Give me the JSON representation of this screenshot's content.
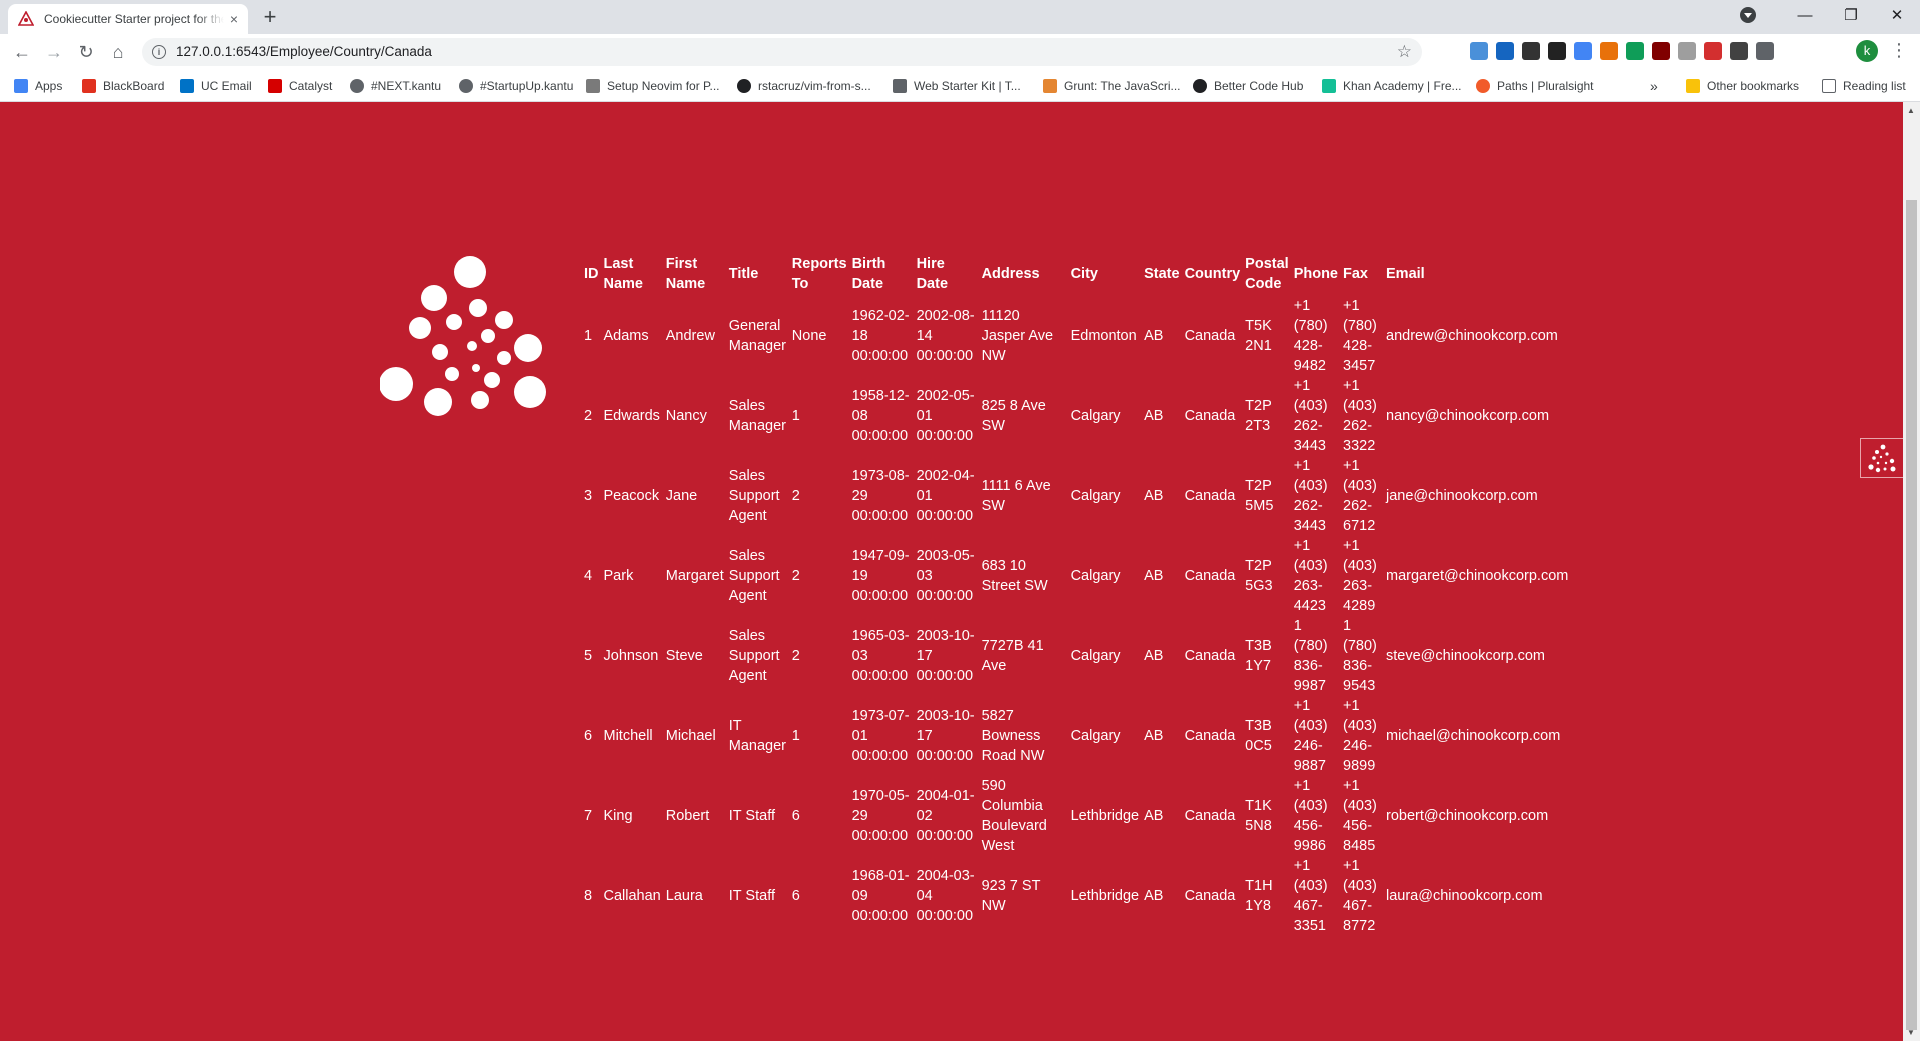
{
  "browser": {
    "tab_title": "Cookiecutter Starter project for the Pyramid Web Framework",
    "tab_close": "×",
    "new_tab": "+",
    "url": "127.0.0.1:6543/Employee/Country/Canada",
    "profile_initial": "k",
    "window_controls": {
      "minimize": "—",
      "restore": "❐",
      "close": "✕"
    }
  },
  "bookmarks": {
    "items": [
      {
        "label": "Apps",
        "icon": "apps-grid-icon",
        "color": "#4285f4"
      },
      {
        "label": "BlackBoard",
        "icon": "blackboard-icon",
        "color": "#e0311f"
      },
      {
        "label": "UC Email",
        "icon": "outlook-icon",
        "color": "#0072c6"
      },
      {
        "label": "Catalyst",
        "icon": "catalyst-icon",
        "color": "#d50000"
      },
      {
        "label": "#NEXT.kantu",
        "icon": "globe-icon",
        "color": "#5f6368"
      },
      {
        "label": "#StartupUp.kantu",
        "icon": "globe-icon",
        "color": "#5f6368"
      },
      {
        "label": "Setup Neovim for P...",
        "icon": "neovim-icon",
        "color": "#7a7a7a"
      },
      {
        "label": "rstacruz/vim-from-s...",
        "icon": "github-icon",
        "color": "#202124"
      },
      {
        "label": "Web Starter Kit | T...",
        "icon": "code-icon",
        "color": "#5f6368"
      },
      {
        "label": "Grunt: The JavaScri...",
        "icon": "grunt-icon",
        "color": "#e48632"
      },
      {
        "label": "Better Code Hub",
        "icon": "github-icon",
        "color": "#202124"
      },
      {
        "label": "Khan Academy | Fre...",
        "icon": "khan-icon",
        "color": "#14bf96"
      },
      {
        "label": "Paths | Pluralsight",
        "icon": "pluralsight-icon",
        "color": "#f15b2a"
      }
    ],
    "overflow": "»",
    "other": "Other bookmarks",
    "reading": "Reading list"
  },
  "table": {
    "headers": {
      "id": "ID",
      "last": "Last Name",
      "first": "First Name",
      "title": "Title",
      "reports": "Reports To",
      "birth": "Birth Date",
      "hire": "Hire Date",
      "address": "Address",
      "city": "City",
      "state": "State",
      "country": "Country",
      "postal": "Postal Code",
      "phone": "Phone",
      "fax": "Fax",
      "email": "Email"
    },
    "rows": [
      {
        "id": "1",
        "last": "Adams",
        "first": "Andrew",
        "title": "General Manager",
        "reports": "None",
        "birth": "1962-02-18 00:00:00",
        "hire": "2002-08-14 00:00:00",
        "address": "11120 Jasper Ave NW",
        "city": "Edmonton",
        "state": "AB",
        "country": "Canada",
        "postal": "T5K 2N1",
        "phone": "+1 (780) 428-9482",
        "fax": "+1 (780) 428-3457",
        "email": "andrew@chinookcorp.com"
      },
      {
        "id": "2",
        "last": "Edwards",
        "first": "Nancy",
        "title": "Sales Manager",
        "reports": "1",
        "birth": "1958-12-08 00:00:00",
        "hire": "2002-05-01 00:00:00",
        "address": "825 8 Ave SW",
        "city": "Calgary",
        "state": "AB",
        "country": "Canada",
        "postal": "T2P 2T3",
        "phone": "+1 (403) 262-3443",
        "fax": "+1 (403) 262-3322",
        "email": "nancy@chinookcorp.com"
      },
      {
        "id": "3",
        "last": "Peacock",
        "first": "Jane",
        "title": "Sales Support Agent",
        "reports": "2",
        "birth": "1973-08-29 00:00:00",
        "hire": "2002-04-01 00:00:00",
        "address": "1111 6 Ave SW",
        "city": "Calgary",
        "state": "AB",
        "country": "Canada",
        "postal": "T2P 5M5",
        "phone": "+1 (403) 262-3443",
        "fax": "+1 (403) 262-6712",
        "email": "jane@chinookcorp.com"
      },
      {
        "id": "4",
        "last": "Park",
        "first": "Margaret",
        "title": "Sales Support Agent",
        "reports": "2",
        "birth": "1947-09-19 00:00:00",
        "hire": "2003-05-03 00:00:00",
        "address": "683 10 Street SW",
        "city": "Calgary",
        "state": "AB",
        "country": "Canada",
        "postal": "T2P 5G3",
        "phone": "+1 (403) 263-4423",
        "fax": "+1 (403) 263-4289",
        "email": "margaret@chinookcorp.com"
      },
      {
        "id": "5",
        "last": "Johnson",
        "first": "Steve",
        "title": "Sales Support Agent",
        "reports": "2",
        "birth": "1965-03-03 00:00:00",
        "hire": "2003-10-17 00:00:00",
        "address": "7727B 41 Ave",
        "city": "Calgary",
        "state": "AB",
        "country": "Canada",
        "postal": "T3B 1Y7",
        "phone": "1 (780) 836-9987",
        "fax": "1 (780) 836-9543",
        "email": "steve@chinookcorp.com"
      },
      {
        "id": "6",
        "last": "Mitchell",
        "first": "Michael",
        "title": "IT Manager",
        "reports": "1",
        "birth": "1973-07-01 00:00:00",
        "hire": "2003-10-17 00:00:00",
        "address": "5827 Bowness Road NW",
        "city": "Calgary",
        "state": "AB",
        "country": "Canada",
        "postal": "T3B 0C5",
        "phone": "+1 (403) 246-9887",
        "fax": "+1 (403) 246-9899",
        "email": "michael@chinookcorp.com"
      },
      {
        "id": "7",
        "last": "King",
        "first": "Robert",
        "title": "IT Staff",
        "reports": "6",
        "birth": "1970-05-29 00:00:00",
        "hire": "2004-01-02 00:00:00",
        "address": "590 Columbia Boulevard West",
        "city": "Lethbridge",
        "state": "AB",
        "country": "Canada",
        "postal": "T1K 5N8",
        "phone": "+1 (403) 456-9986",
        "fax": "+1 (403) 456-8485",
        "email": "robert@chinookcorp.com"
      },
      {
        "id": "8",
        "last": "Callahan",
        "first": "Laura",
        "title": "IT Staff",
        "reports": "6",
        "birth": "1968-01-09 00:00:00",
        "hire": "2004-03-04 00:00:00",
        "address": "923 7 ST NW",
        "city": "Lethbridge",
        "state": "AB",
        "country": "Canada",
        "postal": "T1H 1Y8",
        "phone": "+1 (403) 467-3351",
        "fax": "+1 (403) 467-8772",
        "email": "laura@chinookcorp.com"
      }
    ]
  },
  "colors": {
    "page_background": "#bf1e2e",
    "text": "#ffffff"
  }
}
